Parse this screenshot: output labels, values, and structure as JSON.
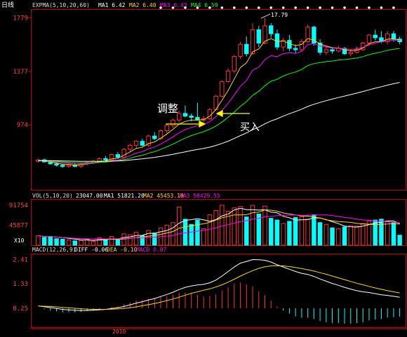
{
  "period_label": "日线",
  "main_panel": {
    "header": {
      "name": "EXPMA(5,10,20,60)",
      "ma1": "MA1 6.42",
      "ma2": "MA2 6.40",
      "ma3": "MA3 6.43",
      "ma4": "MA4 6.59"
    },
    "y_ticks": [
      "1779",
      "1377",
      "974"
    ],
    "peak_label": "17.79",
    "annotation_adjust": "调整",
    "annotation_buy": "买入"
  },
  "volume_panel": {
    "header": {
      "name": "VOL(5,10,20)",
      "v1": "23047.00",
      "ma1": "MA1 51821.20",
      "ma2": "MA2 45453.10",
      "ma3": "MA3 56429.55"
    },
    "y_ticks": [
      "91754",
      "45877"
    ],
    "unit_label": "X10"
  },
  "macd_panel": {
    "header": {
      "name": "MACD(12,26,9)",
      "diff": "DIFF -0.06",
      "dea": "DEA -0.10",
      "macd": "MACD 0.07"
    },
    "y_ticks": [
      "2.41",
      "1.33",
      "0.25"
    ]
  },
  "x_axis_label": "2010",
  "colors": {
    "background": "#000000",
    "up": "#ff3030",
    "down": "#00ffff",
    "frame": "#c00000",
    "axis_text": "#ff4040",
    "ma1": "#ffffff",
    "ma2": "#ffd700",
    "ma3": "#ff00ff",
    "ma4": "#00ff00",
    "dea": "#ffd700",
    "annotation_arrow": "#ffff00"
  },
  "chart_data": {
    "type": "candlestick",
    "title": "",
    "main_ylim": [
      5.0,
      18.3
    ],
    "candles": [
      [
        7.0,
        7.2,
        6.9,
        7.1
      ],
      [
        7.1,
        7.2,
        6.9,
        6.95
      ],
      [
        6.9,
        7.0,
        6.75,
        6.8
      ],
      [
        6.8,
        6.9,
        6.6,
        6.7
      ],
      [
        6.7,
        6.8,
        6.5,
        6.6
      ],
      [
        6.6,
        6.8,
        6.5,
        6.7
      ],
      [
        6.7,
        6.85,
        6.55,
        6.6
      ],
      [
        6.6,
        6.9,
        6.5,
        6.8
      ],
      [
        6.8,
        6.95,
        6.7,
        6.9
      ],
      [
        6.9,
        7.1,
        6.8,
        7.0
      ],
      [
        7.0,
        7.3,
        6.9,
        7.2
      ],
      [
        7.2,
        7.4,
        7.0,
        7.1
      ],
      [
        7.1,
        7.6,
        7.05,
        7.5
      ],
      [
        7.5,
        7.7,
        7.2,
        7.3
      ],
      [
        7.3,
        8.0,
        7.2,
        7.9
      ],
      [
        7.9,
        8.3,
        7.7,
        8.2
      ],
      [
        8.2,
        8.6,
        8.0,
        8.5
      ],
      [
        8.5,
        8.7,
        8.1,
        8.2
      ],
      [
        8.2,
        9.0,
        8.1,
        8.9
      ],
      [
        8.9,
        9.2,
        8.6,
        8.7
      ],
      [
        8.7,
        9.4,
        8.6,
        9.3
      ],
      [
        9.3,
        9.8,
        9.1,
        9.7
      ],
      [
        9.7,
        10.2,
        9.5,
        10.1
      ],
      [
        10.1,
        10.8,
        9.9,
        10.6
      ],
      [
        10.6,
        11.2,
        10.3,
        10.4
      ],
      [
        10.4,
        10.6,
        10.0,
        10.3
      ],
      [
        10.3,
        11.4,
        10.2,
        10.1
      ],
      [
        10.1,
        10.4,
        9.9,
        10.2
      ],
      [
        10.2,
        11.0,
        10.1,
        10.9
      ],
      [
        10.9,
        12.0,
        10.8,
        11.9
      ],
      [
        11.9,
        13.1,
        11.8,
        13.0
      ],
      [
        13.0,
        14.0,
        12.9,
        13.8
      ],
      [
        13.8,
        15.0,
        13.6,
        14.9
      ],
      [
        14.9,
        16.0,
        14.7,
        15.8
      ],
      [
        15.8,
        16.4,
        14.9,
        15.1
      ],
      [
        15.1,
        17.4,
        15.0,
        16.9
      ],
      [
        16.9,
        17.2,
        15.6,
        15.9
      ],
      [
        15.9,
        17.8,
        15.8,
        17.2
      ],
      [
        17.2,
        17.4,
        16.3,
        16.6
      ],
      [
        16.6,
        16.9,
        15.4,
        15.6
      ],
      [
        15.6,
        16.3,
        15.3,
        16.1
      ],
      [
        16.1,
        16.5,
        15.3,
        15.5
      ],
      [
        15.5,
        15.8,
        15.1,
        15.4
      ],
      [
        15.4,
        16.2,
        15.3,
        16.0
      ],
      [
        16.0,
        17.3,
        15.9,
        17.1
      ],
      [
        17.1,
        17.2,
        15.7,
        15.9
      ],
      [
        15.9,
        16.2,
        15.0,
        15.2
      ],
      [
        15.2,
        15.6,
        15.0,
        15.4
      ],
      [
        15.4,
        15.6,
        15.1,
        15.3
      ],
      [
        15.3,
        15.7,
        15.2,
        15.5
      ],
      [
        15.5,
        15.6,
        15.0,
        15.1
      ],
      [
        15.1,
        15.4,
        14.9,
        15.2
      ],
      [
        15.2,
        15.6,
        15.1,
        15.4
      ],
      [
        15.4,
        16.0,
        15.3,
        15.9
      ],
      [
        15.9,
        16.6,
        15.7,
        16.5
      ],
      [
        16.5,
        16.9,
        16.1,
        16.3
      ],
      [
        16.3,
        16.8,
        15.9,
        16.0
      ],
      [
        16.0,
        16.8,
        15.8,
        16.6
      ],
      [
        16.6,
        16.8,
        16.0,
        16.2
      ],
      [
        16.2,
        16.4,
        15.8,
        16.0
      ]
    ],
    "ma_ema5": [
      7.05,
      7.02,
      6.95,
      6.86,
      6.77,
      6.75,
      6.7,
      6.73,
      6.79,
      6.86,
      6.97,
      7.02,
      7.18,
      7.22,
      7.45,
      7.7,
      7.97,
      8.05,
      8.33,
      8.45,
      8.73,
      9.05,
      9.4,
      9.8,
      10.0,
      10.1,
      10.1,
      10.13,
      10.39,
      10.89,
      11.59,
      12.33,
      13.19,
      14.06,
      14.41,
      15.24,
      15.46,
      16.04,
      16.23,
      16.02,
      16.05,
      15.86,
      15.71,
      15.8,
      16.24,
      16.13,
      15.82,
      15.68,
      15.55,
      15.53,
      15.39,
      15.33,
      15.35,
      15.53,
      15.85,
      16.0,
      16.0,
      16.2,
      16.2,
      16.13
    ],
    "ma_ema10": [
      7.05,
      7.03,
      6.99,
      6.93,
      6.87,
      6.84,
      6.79,
      6.79,
      6.81,
      6.84,
      6.91,
      6.95,
      7.05,
      7.09,
      7.24,
      7.41,
      7.61,
      7.72,
      7.93,
      8.07,
      8.29,
      8.55,
      8.83,
      9.15,
      9.38,
      9.55,
      9.66,
      9.76,
      9.97,
      10.35,
      10.83,
      11.37,
      11.98,
      12.66,
      13.07,
      13.85,
      14.09,
      14.66,
      14.95,
      14.88,
      15.1,
      15.17,
      15.12,
      15.28,
      15.79,
      15.85,
      15.67,
      15.61,
      15.52,
      15.52,
      15.47,
      15.43,
      15.46,
      15.58,
      15.75,
      15.9,
      16.0,
      16.1,
      16.1,
      16.1
    ],
    "ma_ema20": [
      7.05,
      7.04,
      7.02,
      6.99,
      6.95,
      6.92,
      6.89,
      6.88,
      6.88,
      6.89,
      6.91,
      6.93,
      6.99,
      7.03,
      7.12,
      7.23,
      7.35,
      7.45,
      7.6,
      7.72,
      7.89,
      8.08,
      8.29,
      8.52,
      8.74,
      8.93,
      9.08,
      9.23,
      9.41,
      9.65,
      9.95,
      10.31,
      10.7,
      11.14,
      11.49,
      11.95,
      12.27,
      12.69,
      13.02,
      13.17,
      13.42,
      13.59,
      13.72,
      13.91,
      14.21,
      14.35,
      14.43,
      14.5,
      14.55,
      14.62,
      14.66,
      14.71,
      14.77,
      14.88,
      15.03,
      15.14,
      15.23,
      15.36,
      15.44,
      15.49
    ],
    "ma_ema60": [
      7.05,
      7.05,
      7.04,
      7.03,
      7.02,
      7.01,
      7.0,
      6.99,
      6.99,
      6.99,
      6.99,
      7.0,
      7.01,
      7.02,
      7.05,
      7.09,
      7.14,
      7.18,
      7.24,
      7.29,
      7.36,
      7.44,
      7.52,
      7.62,
      7.71,
      7.8,
      7.88,
      7.96,
      8.06,
      8.19,
      8.34,
      8.51,
      8.71,
      8.93,
      9.13,
      9.37,
      9.57,
      9.82,
      10.03,
      10.2,
      10.4,
      10.58,
      10.74,
      10.92,
      11.13,
      11.29,
      11.43,
      11.56,
      11.68,
      11.8,
      11.91,
      12.02,
      12.13,
      12.25,
      12.38,
      12.5,
      12.61,
      12.73,
      12.84,
      12.94
    ],
    "volume": [
      22000,
      18000,
      20000,
      15000,
      14000,
      12000,
      10000,
      11000,
      13000,
      9000,
      17000,
      14000,
      20000,
      12000,
      26000,
      24000,
      30000,
      22000,
      34000,
      28000,
      40000,
      46000,
      52000,
      88000,
      60000,
      48000,
      58000,
      38000,
      70000,
      80000,
      92000,
      78000,
      86000,
      89000,
      65000,
      91754,
      72000,
      90000,
      62000,
      58000,
      50000,
      55000,
      64000,
      66000,
      60000,
      70000,
      52000,
      48000,
      40000,
      38000,
      42000,
      45000,
      44000,
      50000,
      56000,
      58000,
      60000,
      55000,
      52000,
      23047
    ],
    "vol_ylim": [
      0,
      100000
    ],
    "macd_diff": [
      0.35,
      0.32,
      0.28,
      0.24,
      0.2,
      0.18,
      0.16,
      0.15,
      0.15,
      0.16,
      0.18,
      0.2,
      0.24,
      0.27,
      0.33,
      0.4,
      0.48,
      0.54,
      0.62,
      0.68,
      0.77,
      0.86,
      0.96,
      1.08,
      1.18,
      1.24,
      1.28,
      1.31,
      1.38,
      1.5,
      1.68,
      1.88,
      2.08,
      2.25,
      2.33,
      2.41,
      2.4,
      2.38,
      2.3,
      2.18,
      2.08,
      1.98,
      1.88,
      1.8,
      1.75,
      1.66,
      1.55,
      1.45,
      1.35,
      1.27,
      1.18,
      1.1,
      1.03,
      0.98,
      0.95,
      0.9,
      0.85,
      0.82,
      0.78,
      0.74
    ],
    "macd_dea": [
      0.35,
      0.34,
      0.33,
      0.31,
      0.29,
      0.27,
      0.25,
      0.23,
      0.21,
      0.2,
      0.2,
      0.2,
      0.21,
      0.22,
      0.24,
      0.27,
      0.31,
      0.36,
      0.41,
      0.46,
      0.52,
      0.59,
      0.66,
      0.74,
      0.83,
      0.91,
      0.98,
      1.05,
      1.11,
      1.19,
      1.29,
      1.41,
      1.54,
      1.68,
      1.8,
      1.92,
      2.02,
      2.09,
      2.13,
      2.14,
      2.13,
      2.1,
      2.06,
      2.01,
      1.96,
      1.9,
      1.83,
      1.76,
      1.68,
      1.6,
      1.52,
      1.44,
      1.36,
      1.29,
      1.22,
      1.15,
      1.09,
      1.03,
      0.98,
      0.93
    ],
    "macd_ylim": [
      0.0,
      2.55
    ]
  }
}
